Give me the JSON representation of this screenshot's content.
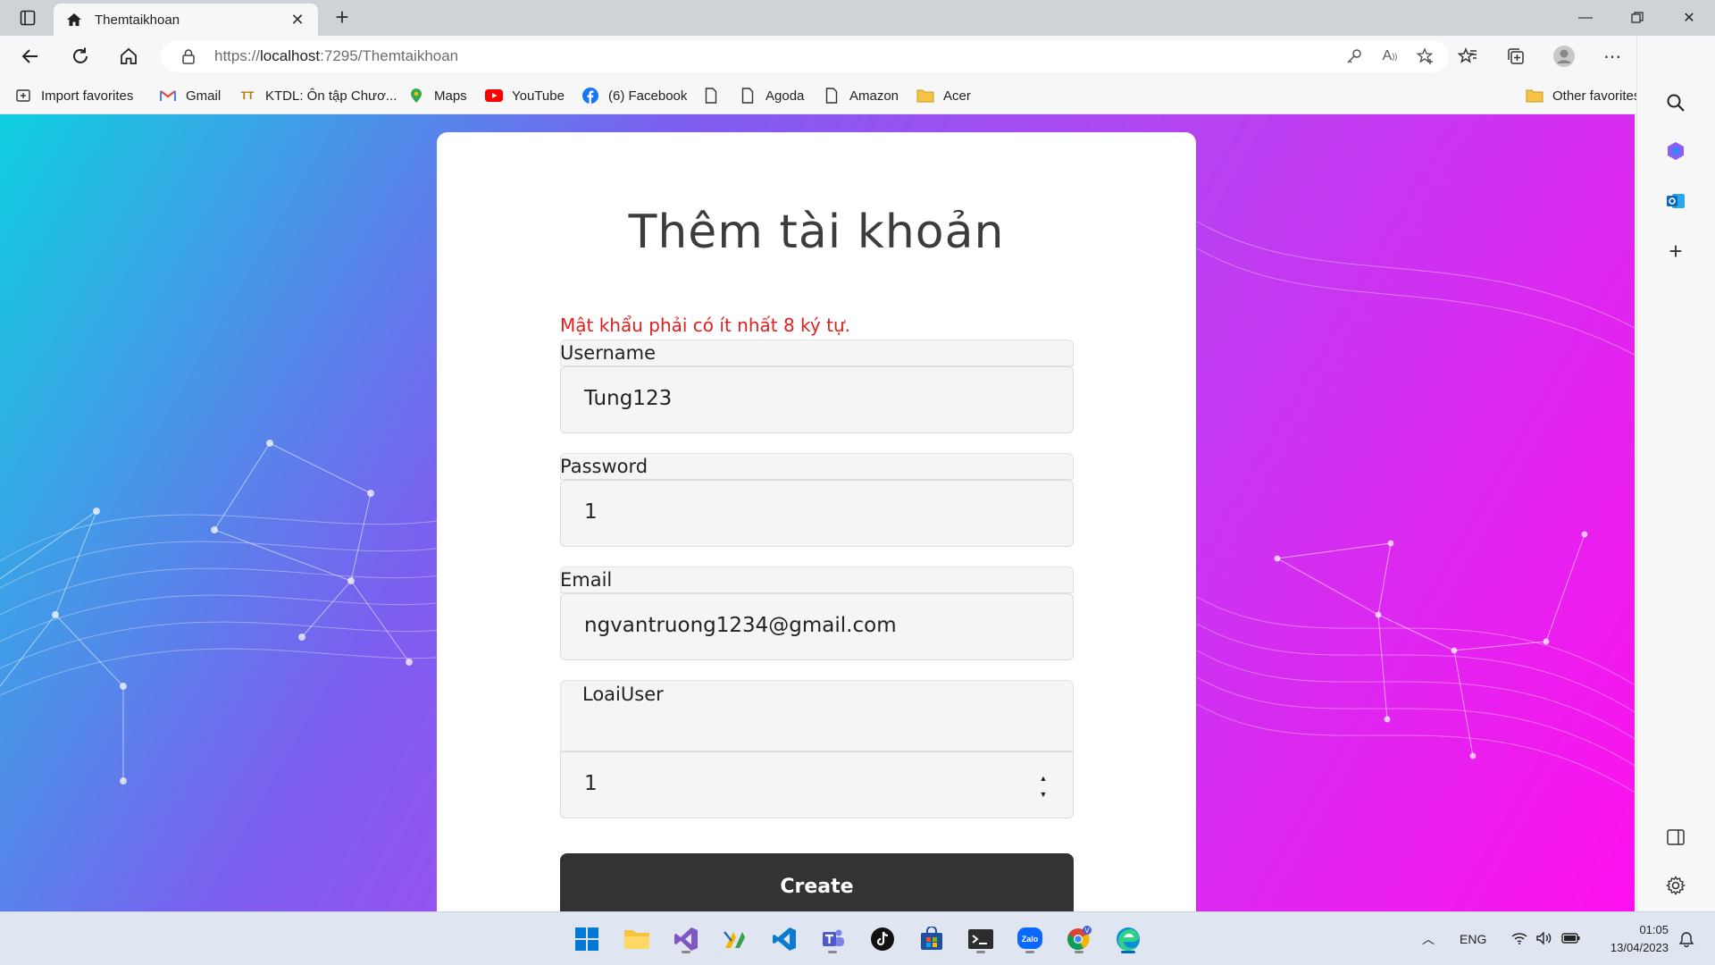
{
  "browser": {
    "tab_title": "Themtaikhoan",
    "url_prefix": "https://",
    "url_host": "localhost",
    "url_path": ":7295/Themtaikhoan",
    "favorites": [
      {
        "label": "Import favorites",
        "icon": "import-icon"
      },
      {
        "label": "Gmail",
        "icon": "gmail-icon"
      },
      {
        "label": "KTDL: Ôn tập Chươ...",
        "icon": "site-icon"
      },
      {
        "label": "Maps",
        "icon": "maps-icon"
      },
      {
        "label": "YouTube",
        "icon": "youtube-icon"
      },
      {
        "label": "(6) Facebook",
        "icon": "facebook-icon"
      },
      {
        "label": "",
        "icon": "page-icon"
      },
      {
        "label": "Agoda",
        "icon": "page-icon"
      },
      {
        "label": "Amazon",
        "icon": "page-icon"
      },
      {
        "label": "Acer",
        "icon": "folder-icon"
      }
    ],
    "other_favorites": "Other favorites"
  },
  "form": {
    "title": "Thêm tài khoản",
    "error": "Mật khẩu phải có ít nhất 8 ký tự.",
    "username_label": "Username",
    "username_value": "Tung123",
    "password_label": "Password",
    "password_value": "1",
    "email_label": "Email",
    "email_value": "ngvantruong1234@gmail.com",
    "loaiuser_label": "LoaiUser",
    "loaiuser_value": "1",
    "create_label": "Create"
  },
  "taskbar": {
    "lang": "ENG",
    "time": "01:05",
    "date": "13/04/2023",
    "apps": [
      "start-icon",
      "file-explorer-icon",
      "visual-studio-icon",
      "sql-icon",
      "vscode-icon",
      "teams-icon",
      "tiktok-icon",
      "store-icon",
      "terminal-icon",
      "zalo-icon",
      "chrome-icon",
      "edge-icon"
    ]
  },
  "colors": {
    "accent_error": "#e02020",
    "button": "#333333",
    "gradient_left": "#0fd0e0",
    "gradient_right": "#ff10ee"
  }
}
